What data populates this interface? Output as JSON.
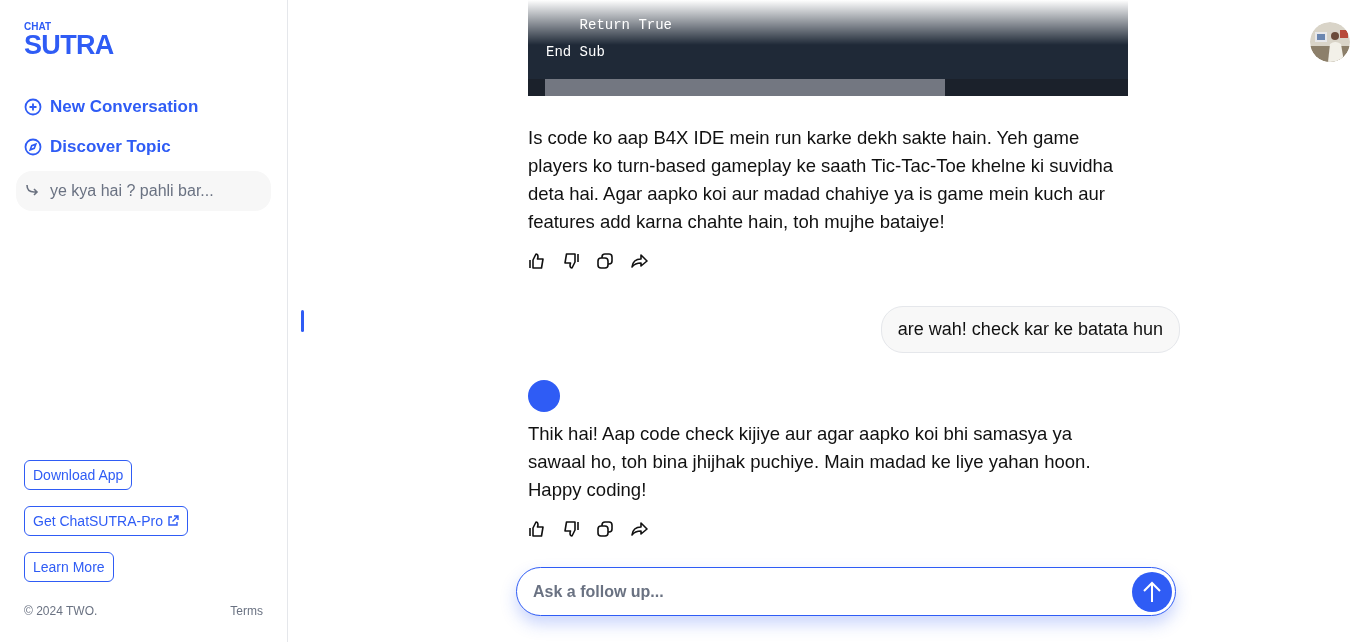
{
  "sidebar": {
    "logo": {
      "small": "CHAT",
      "main": "SUTRA"
    },
    "nav": [
      {
        "kind": "new",
        "label": "New Conversation"
      },
      {
        "kind": "discover",
        "label": "Discover Topic"
      }
    ],
    "history": [
      {
        "label": "ye kya hai ? pahli bar..."
      }
    ],
    "links": [
      {
        "label": "Download App",
        "external": false
      },
      {
        "label": "Get ChatSUTRA-Pro",
        "external": true
      },
      {
        "label": "Learn More",
        "external": false
      }
    ],
    "footer": {
      "copyright": "© 2024 TWO.",
      "terms": "Terms"
    }
  },
  "messages": [
    {
      "kind": "code",
      "lines": [
        "    Return True",
        "End Sub"
      ]
    },
    {
      "kind": "assistant",
      "avatar": false,
      "text": "Is code ko aap B4X IDE mein run karke dekh sakte hain. Yeh game players ko turn-based gameplay ke saath Tic-Tac-Toe khelne ki suvidha deta hai. Agar aapko koi aur madad chahiye ya is game mein kuch aur features add karna chahte hain, toh mujhe bataiye!"
    },
    {
      "kind": "user",
      "text": "are wah! check kar ke batata hun"
    },
    {
      "kind": "assistant",
      "avatar": true,
      "text": "Thik hai! Aap code check kijiye aur agar aapko koi bhi samasya ya sawaal ho, toh bina jhijhak puchiye. Main madad ke liye yahan hoon. Happy coding!"
    }
  ],
  "composer": {
    "placeholder": "Ask a follow up..."
  }
}
